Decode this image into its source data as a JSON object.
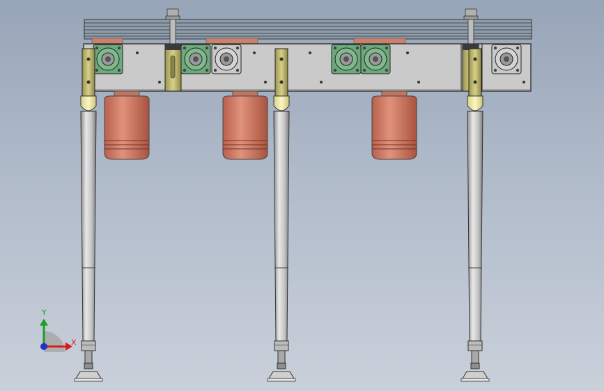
{
  "viewport": {
    "colors": {
      "background_top": "#97a5b8",
      "background_bottom": "#c9d0da",
      "frame": "#c9c9c9",
      "belt": "#8f9fae",
      "motor": "#d5826c",
      "bearing": "#6fa97d",
      "bracket": "#b8b16a",
      "leg": "#c2c2c2"
    }
  },
  "triad": {
    "x_label": "X",
    "y_label": "Y",
    "colors": {
      "x": "#d31f1f",
      "y": "#1f9d2a",
      "z": "#1f33c9"
    }
  }
}
